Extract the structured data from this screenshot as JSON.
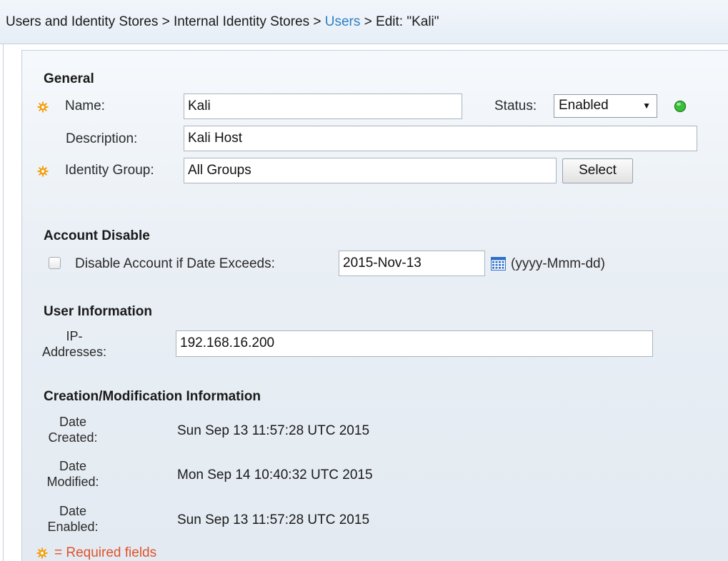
{
  "breadcrumb": {
    "part1": "Users and Identity Stores",
    "sep1": " > ",
    "part2": "Internal Identity Stores",
    "sep2": " > ",
    "part3": "Users",
    "sep3": " > ",
    "part4": "Edit: \"Kali\""
  },
  "general": {
    "heading": "General",
    "name_label": "Name:",
    "name_value": "Kali",
    "status_label": "Status:",
    "status_value": "Enabled",
    "description_label": "Description:",
    "description_value": "Kali Host",
    "identity_group_label": "Identity Group:",
    "identity_group_value": "All Groups",
    "select_button": "Select"
  },
  "account_disable": {
    "heading": "Account Disable",
    "checkbox_label": "Disable Account if Date Exceeds:",
    "date_value": "2015-Nov-13",
    "date_format": "(yyyy-Mmm-dd)",
    "checked": false
  },
  "user_information": {
    "heading": "User Information",
    "ip_label_line1": "IP-",
    "ip_label_line2": "Addresses:",
    "ip_value": "192.168.16.200"
  },
  "creation_info": {
    "heading": "Creation/Modification Information",
    "rows": [
      {
        "label_line1": "Date",
        "label_line2": "Created:",
        "value": "Sun Sep 13 11:57:28 UTC 2015"
      },
      {
        "label_line1": "Date",
        "label_line2": "Modified:",
        "value": "Mon Sep 14 10:40:32 UTC 2015"
      },
      {
        "label_line1": "Date",
        "label_line2": "Enabled:",
        "value": "Sun Sep 13 11:57:28 UTC 2015"
      }
    ]
  },
  "footer": {
    "required_text": "= Required fields"
  },
  "icons": {
    "required": "gear-icon",
    "status": "status-green-dot-icon",
    "calendar": "calendar-icon"
  },
  "colors": {
    "link": "#2e7fc3",
    "required": "#e0532b",
    "required_icon": "#f3a10f",
    "status_enabled": "#3bbf3b",
    "calendar": "#2f6fc7"
  }
}
